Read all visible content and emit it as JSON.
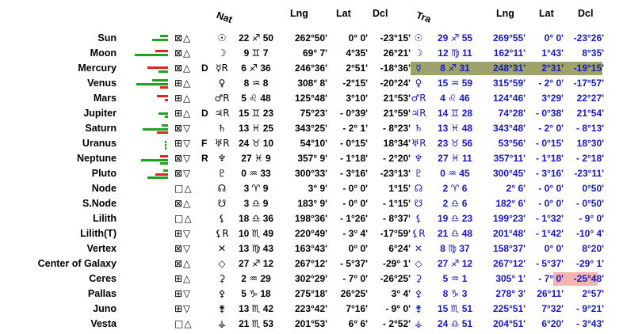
{
  "headers": {
    "nat": "Nat",
    "lng": "Lng",
    "lat": "Lat",
    "dcl": "Dcl",
    "tra": "Tra",
    "tlng": "Lng",
    "tlat": "Lat",
    "tdcl": "Dcl"
  },
  "colors": {
    "green": "#22a022",
    "red": "#e82020",
    "blue": "#1616c8",
    "highlight_green": "#9ea36c",
    "highlight_pink": "#f4b4b4"
  },
  "rows": [
    {
      "name": "Sun",
      "aspects": "⊠△",
      "flag": "",
      "nsym": "☉",
      "npos": "22 ♐ 50",
      "lng": "262°50'",
      "lat": "0° 0'",
      "dcl": "-23°15'",
      "tsym": "☉",
      "tpos": "29 ♐ 55",
      "tlng": "269°55'",
      "tlat": "0° 0'",
      "tdcl": "-23°26'"
    },
    {
      "name": "Moon",
      "aspects": "⊠△",
      "flag": "",
      "nsym": "☽",
      "npos": "9 ♊ 7",
      "lng": "69° 7'",
      "lat": "4°35'",
      "dcl": "26°21'",
      "tsym": "☽",
      "tpos": "12 ♍ 11",
      "tlng": "162°11'",
      "tlat": "1°43'",
      "tdcl": "8°35'"
    },
    {
      "name": "Mercury",
      "aspects": "⊠△",
      "flag": "D",
      "nsym": "☿R",
      "npos": "6 ♐ 36",
      "lng": "246°36'",
      "lat": "2°51'",
      "dcl": "-18°36'",
      "tsym": "☿",
      "tpos": "8 ♐ 31",
      "tlng": "248°31'",
      "tlat": "2°31'",
      "tdcl": "-19°15'"
    },
    {
      "name": "Venus",
      "aspects": "⊞△",
      "flag": "",
      "nsym": "♀",
      "npos": "8 ♒ 8",
      "lng": "308° 8'",
      "lat": "-2°15'",
      "dcl": "-20°24'",
      "tsym": "♀",
      "tpos": "15 ♒ 59",
      "tlng": "315°59'",
      "tlat": "- 2° 0'",
      "tdcl": "-17°57'"
    },
    {
      "name": "Mars",
      "aspects": "⊞△",
      "flag": "",
      "nsym": "♂R",
      "npos": "5 ♌ 48",
      "lng": "125°48'",
      "lat": "3°10'",
      "dcl": "21°53'",
      "tsym": "♂R",
      "tpos": "4 ♌ 46",
      "tlng": "124°46'",
      "tlat": "3°29'",
      "tdcl": "22°27'"
    },
    {
      "name": "Jupiter",
      "aspects": "⊞△",
      "flag": "D",
      "nsym": "♃R",
      "npos": "15 ♊ 23",
      "lng": "75°23'",
      "lat": "- 0°39'",
      "dcl": "21°59'",
      "tsym": "♃R",
      "tpos": "14 ♊ 28",
      "tlng": "74°28'",
      "tlat": "- 0°38'",
      "tdcl": "21°54'"
    },
    {
      "name": "Saturn",
      "aspects": "⊠▽",
      "flag": "",
      "nsym": "♄",
      "npos": "13 ♓ 25",
      "lng": "343°25'",
      "lat": "- 2° 1'",
      "dcl": "- 8°23'",
      "tsym": "♄",
      "tpos": "13 ♓ 48",
      "tlng": "343°48'",
      "tlat": "- 2° 0'",
      "tdcl": "- 8°13'"
    },
    {
      "name": "Uranus",
      "aspects": "⊞▽",
      "flag": "F",
      "nsym": "♅R",
      "npos": "24 ♉ 10",
      "lng": "54°10'",
      "lat": "- 0°15'",
      "dcl": "18°34'",
      "tsym": "♅R",
      "tpos": "23 ♉ 56",
      "tlng": "53°56'",
      "tlat": "- 0°15'",
      "tdcl": "18°30'"
    },
    {
      "name": "Neptune",
      "aspects": "⊠▽",
      "flag": "R",
      "nsym": "♆",
      "npos": "27 ♓ 9",
      "lng": "357° 9'",
      "lat": "- 1°18'",
      "dcl": "- 2°20'",
      "tsym": "♆",
      "tpos": "27 ♓ 11",
      "tlng": "357°11'",
      "tlat": "- 1°18'",
      "tdcl": "- 2°18'"
    },
    {
      "name": "Pluto",
      "aspects": "⊠▽",
      "flag": "",
      "nsym": "♇",
      "npos": "0 ♒ 33",
      "lng": "300°33'",
      "lat": "- 3°16'",
      "dcl": "-23°13'",
      "tsym": "♇",
      "tpos": "0 ♒ 45",
      "tlng": "300°45'",
      "tlat": "- 3°16'",
      "tdcl": "-23°11'"
    },
    {
      "name": "Node",
      "aspects": "□△",
      "flag": "",
      "nsym": "☊",
      "npos": "3 ♈ 9",
      "lng": "3° 9'",
      "lat": "- 0° 0'",
      "dcl": "1°15'",
      "tsym": "☊",
      "tpos": "2 ♈ 6",
      "tlng": "2° 6'",
      "tlat": "- 0° 0'",
      "tdcl": "0°50'"
    },
    {
      "name": "S.Node",
      "aspects": "⊠△",
      "flag": "",
      "nsym": "☋",
      "npos": "3 ♎ 9",
      "lng": "183° 9'",
      "lat": "- 0° 0'",
      "dcl": "- 1°15'",
      "tsym": "☋",
      "tpos": "2 ♎ 6",
      "tlng": "182° 6'",
      "tlat": "- 0° 0'",
      "tdcl": "- 0°50'"
    },
    {
      "name": "Lilith",
      "aspects": "□△",
      "flag": "",
      "nsym": "⚸",
      "npos": "18 ♎ 36",
      "lng": "198°36'",
      "lat": "- 1°26'",
      "dcl": "- 8°37'",
      "tsym": "⚸",
      "tpos": "19 ♎ 23",
      "tlng": "199°23'",
      "tlat": "- 1°32'",
      "tdcl": "- 9° 0'"
    },
    {
      "name": "Lilith(T)",
      "aspects": "⊞▽",
      "flag": "",
      "nsym": "⚸R",
      "npos": "10 ♏ 49",
      "lng": "220°49'",
      "lat": "- 3° 4'",
      "dcl": "-17°59'",
      "tsym": "⚸R",
      "tpos": "21 ♎ 48",
      "tlng": "201°48'",
      "tlat": "- 1°42'",
      "tdcl": "-10° 4'"
    },
    {
      "name": "Vertex",
      "aspects": "⊠▽",
      "flag": "",
      "nsym": "✕",
      "npos": "13 ♍ 43",
      "lng": "163°43'",
      "lat": "0° 0'",
      "dcl": "6°24'",
      "tsym": "✕",
      "tpos": "8 ♍ 37",
      "tlng": "158°37'",
      "tlat": "0° 0'",
      "tdcl": "8°20'"
    },
    {
      "name": "Center of Galaxy",
      "aspects": "⊠△",
      "flag": "",
      "nsym": "◇",
      "npos": "27 ♐ 12",
      "lng": "267°12'",
      "lat": "- 5°37'",
      "dcl": "-29° 1'",
      "tsym": "◇",
      "tpos": "27 ♐ 12",
      "tlng": "267°12'",
      "tlat": "- 5°37'",
      "tdcl": "-29° 1'"
    },
    {
      "name": "Ceres",
      "aspects": "⊞△",
      "flag": "",
      "nsym": "⚳",
      "npos": "2 ♒ 29",
      "lng": "302°29'",
      "lat": "- 7° 0'",
      "dcl": "-26°25'",
      "tsym": "⚳",
      "tpos": "5 ♒ 1",
      "tlng": "305° 1'",
      "tlat": "- 7° 0'",
      "tdcl": "-25°48'"
    },
    {
      "name": "Pallas",
      "aspects": "⊞▽",
      "flag": "",
      "nsym": "⚴",
      "npos": "5 ♑ 18",
      "lng": "275°18'",
      "lat": "26°25'",
      "dcl": "3° 4'",
      "tsym": "⚴",
      "tpos": "8 ♑ 3",
      "tlng": "278° 3'",
      "tlat": "26°11'",
      "tdcl": "2°57'"
    },
    {
      "name": "Juno",
      "aspects": "⊞▽",
      "flag": "",
      "nsym": "⚵",
      "npos": "13 ♏ 42",
      "lng": "223°42'",
      "lat": "7°16'",
      "dcl": "- 9° 0'",
      "tsym": "⚵",
      "tpos": "15 ♏ 51",
      "tlng": "225°51'",
      "tlat": "7°32'",
      "tdcl": "- 9°21'"
    },
    {
      "name": "Vesta",
      "aspects": "□△",
      "flag": "",
      "nsym": "⚶",
      "npos": "21 ♏ 53",
      "lng": "201°53'",
      "lat": "6° 6'",
      "dcl": "- 2°52'",
      "tsym": "⚶",
      "tpos": "24 ♎ 51",
      "tlng": "204°51'",
      "tlat": "6°20'",
      "tdcl": "- 3°43'"
    }
  ]
}
